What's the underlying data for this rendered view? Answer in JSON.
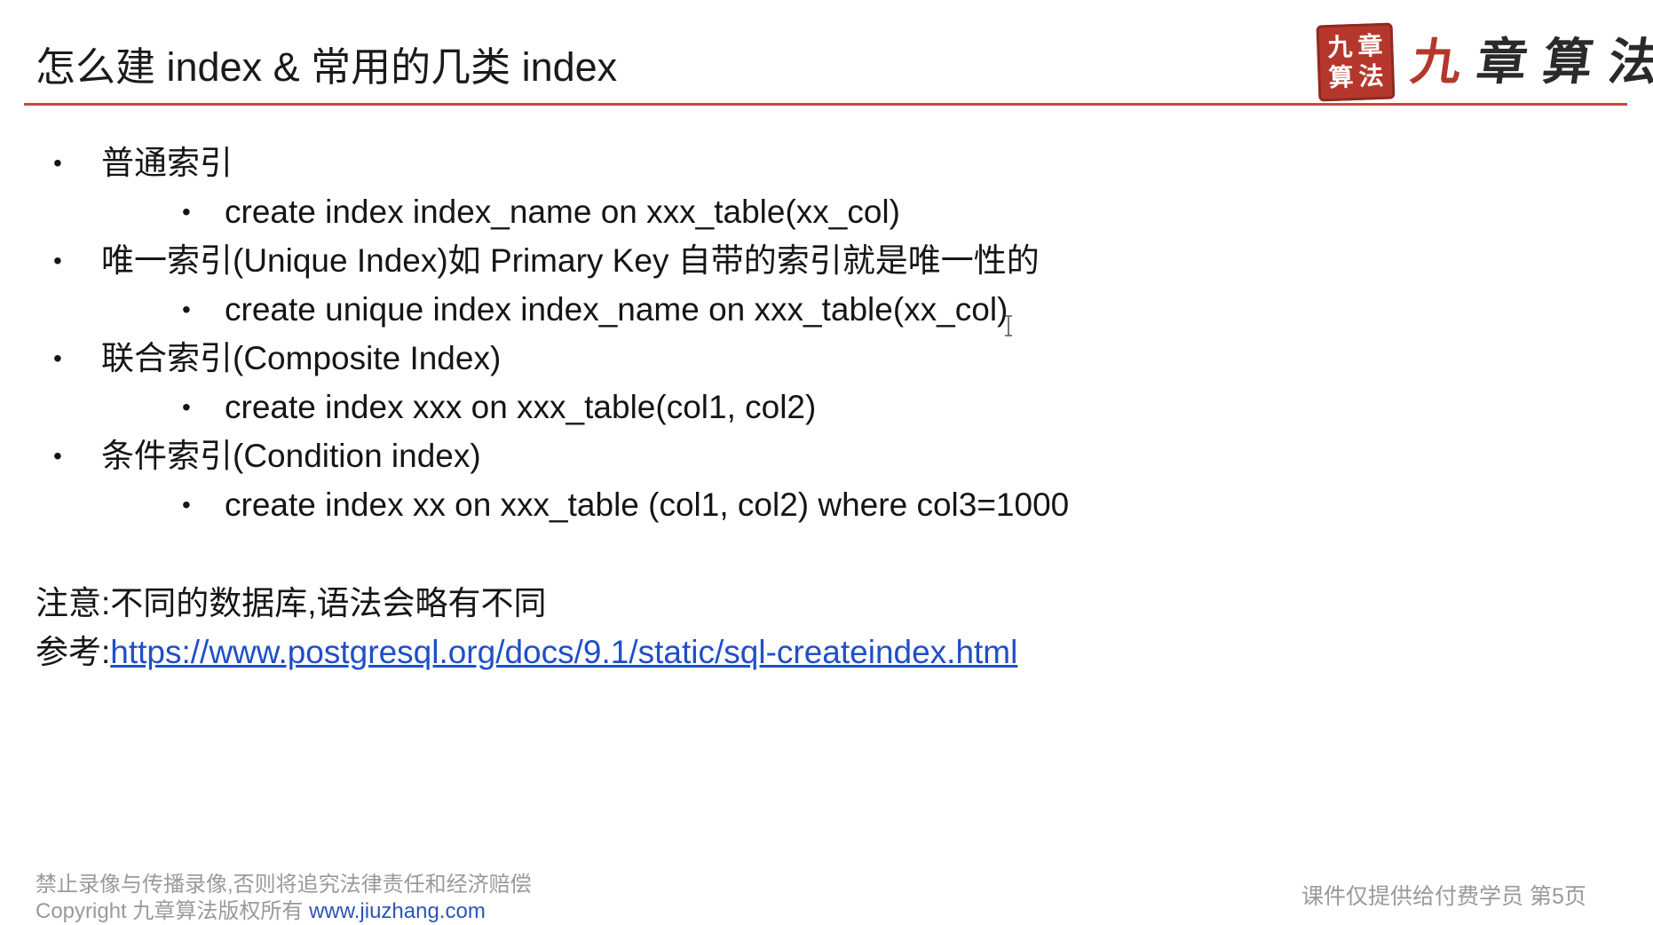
{
  "slide": {
    "title": "怎么建 index & 常用的几类 index",
    "logo": {
      "seal_chars": [
        "九",
        "章",
        "算",
        "法"
      ],
      "brand_chars": [
        "九",
        "章",
        "算",
        "法"
      ]
    },
    "items": [
      {
        "label": "普通索引",
        "sub": "create index index_name on xxx_table(xx_col)"
      },
      {
        "label": "唯一索引(Unique Index)如 Primary Key 自带的索引就是唯一性的",
        "sub": "create unique index index_name on xxx_table(xx_col)"
      },
      {
        "label": "联合索引(Composite Index)",
        "sub": "create index xxx on xxx_table(col1, col2)"
      },
      {
        "label": "条件索引(Condition index)",
        "sub": "create index xx on xxx_table (col1, col2) where col3=1000"
      }
    ],
    "note_line": "注意:不同的数据库,语法会略有不同",
    "reference_label": "参考:",
    "reference_link": "https://www.postgresql.org/docs/9.1/static/sql-createindex.html",
    "footer_left_line1": "禁止录像与传播录像,否则将追究法律责任和经济赔偿",
    "footer_left_copyright": "Copyright 九章算法版权所有",
    "footer_left_url": "www.jiuzhang.com",
    "footer_right": "课件仅提供给付费学员 第5页"
  },
  "colors": {
    "accent_rule": "#c8483c",
    "seal": "#b5372c",
    "link": "#1f4fc8",
    "footer_text": "#9a9a9a"
  }
}
